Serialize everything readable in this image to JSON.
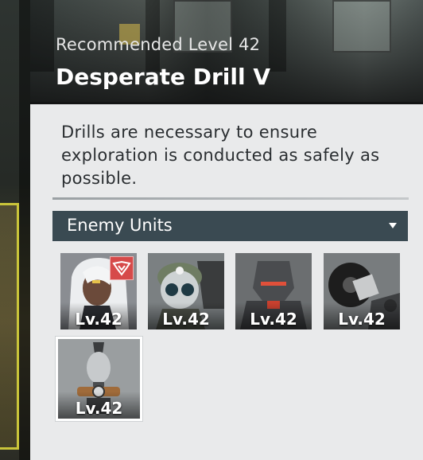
{
  "header": {
    "subtitle": "Recommended Level 42",
    "title": "Desperate Drill V"
  },
  "description": "Drills are necessary to ensure exploration is conducted as safely as possible.",
  "enemy_section": {
    "dropdown_label": "Enemy Units",
    "units": [
      {
        "name": "white-haired-leader",
        "level": "Lv.42",
        "boss_badge": true
      },
      {
        "name": "masked-soldier",
        "level": "Lv.42",
        "boss_badge": false
      },
      {
        "name": "armored-robot",
        "level": "Lv.42",
        "boss_badge": false
      },
      {
        "name": "saw-mech",
        "level": "Lv.42",
        "boss_badge": false
      },
      {
        "name": "bomb-turret",
        "level": "Lv.42",
        "boss_badge": false
      }
    ]
  },
  "colors": {
    "panel_bg": "#e9eaeb",
    "dropdown_bg": "#3a4a52",
    "boss_badge": "#d64a4a",
    "accent_frame": "#c9c43a"
  }
}
